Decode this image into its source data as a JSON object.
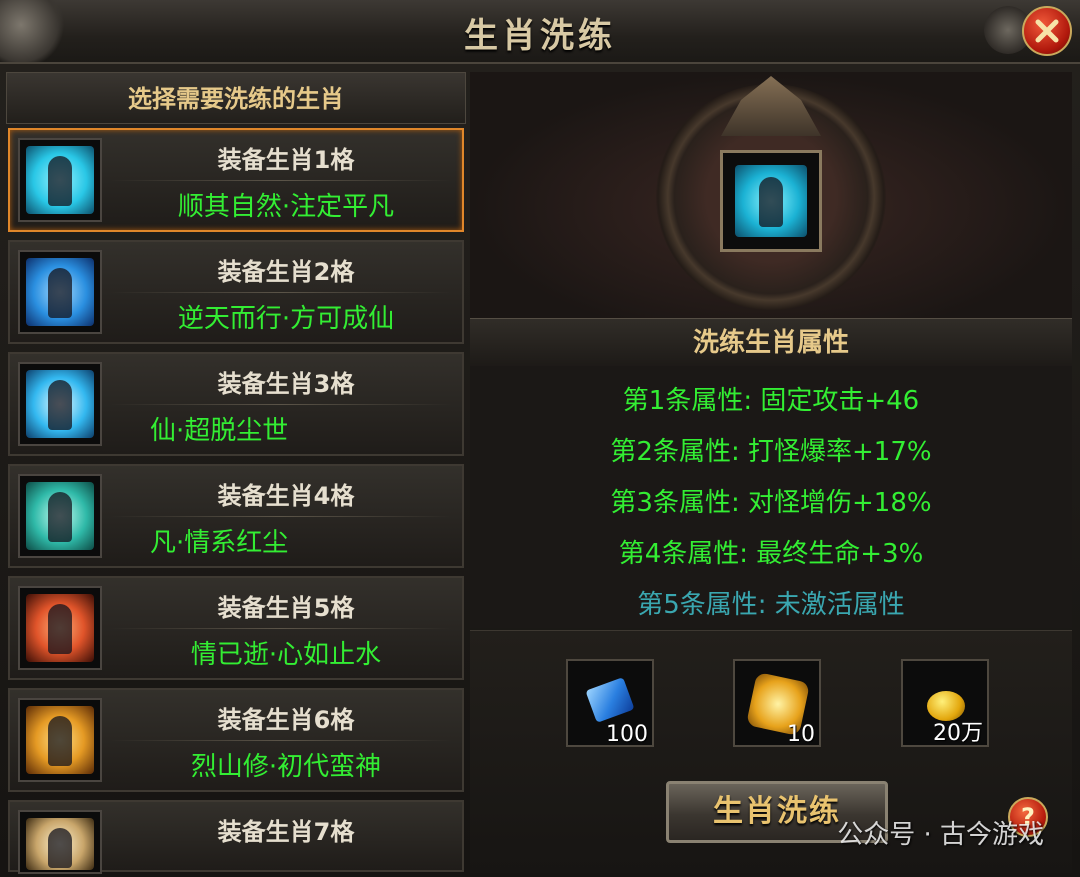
{
  "window": {
    "title": "生肖洗练"
  },
  "left_panel": {
    "header": "选择需要洗练的生肖",
    "slots": [
      {
        "name": "装备生肖1格",
        "desc": "顺其自然·注定平凡",
        "selected": true,
        "icon": "portrait-icon",
        "icon_color": "#29c7e6"
      },
      {
        "name": "装备生肖2格",
        "desc": "逆天而行·方可成仙",
        "selected": false,
        "icon": "portrait-icon",
        "icon_color": "#2a8fe0"
      },
      {
        "name": "装备生肖3格",
        "desc": "仙·超脱尘世",
        "selected": false,
        "icon": "portrait-icon",
        "icon_color": "#33b8f0"
      },
      {
        "name": "装备生肖4格",
        "desc": "凡·情系红尘",
        "selected": false,
        "icon": "portrait-icon",
        "icon_color": "#2fb9a8"
      },
      {
        "name": "装备生肖5格",
        "desc": "情已逝·心如止水",
        "selected": false,
        "icon": "portrait-icon",
        "icon_color": "#e0542a"
      },
      {
        "name": "装备生肖6格",
        "desc": "烈山修·初代蛮神",
        "selected": false,
        "icon": "portrait-icon",
        "icon_color": "#e59a24"
      },
      {
        "name": "装备生肖7格",
        "desc": "",
        "selected": false,
        "icon": "portrait-icon",
        "icon_color": "#c9a66b"
      }
    ]
  },
  "right_panel": {
    "attributes_title": "洗练生肖属性",
    "attributes": [
      {
        "text": "第1条属性: 固定攻击+46",
        "active": true
      },
      {
        "text": "第2条属性: 打怪爆率+17%",
        "active": true
      },
      {
        "text": "第3条属性: 对怪增伤+18%",
        "active": true
      },
      {
        "text": "第4条属性: 最终生命+3%",
        "active": true
      },
      {
        "text": "第5条属性: 未激活属性",
        "active": false
      }
    ],
    "costs": [
      {
        "item": "blue-gem-icon",
        "amount": "100"
      },
      {
        "item": "gold-scroll-icon",
        "amount": "10"
      },
      {
        "item": "gold-coin-icon",
        "amount": "20万"
      }
    ],
    "refine_button": "生肖洗练",
    "help_symbol": "?"
  },
  "watermark": "公众号 · 古今游戏",
  "colors": {
    "accent_green": "#33ee33",
    "inactive_cyan": "#3aa7b0",
    "selected_border": "#e0872a",
    "gold_text": "#e6c98a"
  }
}
